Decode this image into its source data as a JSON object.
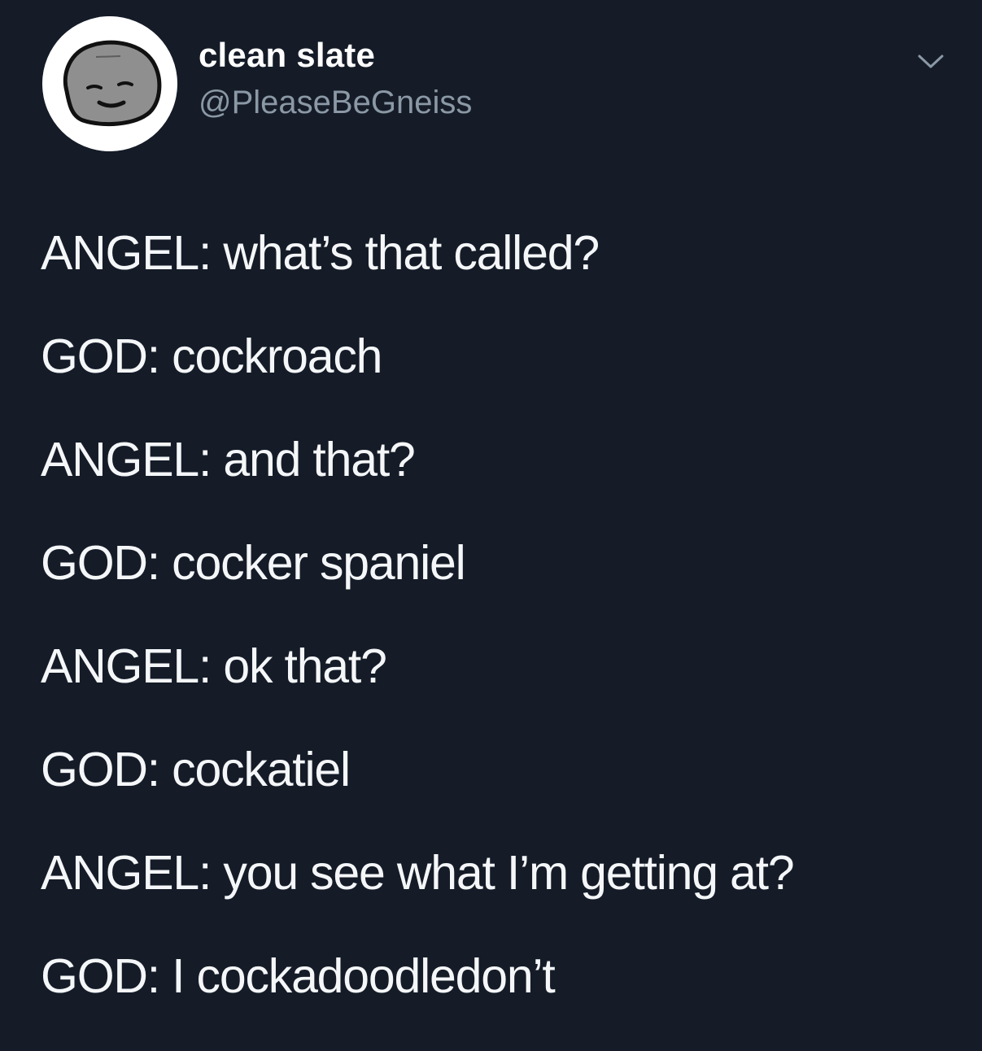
{
  "author": {
    "display_name": "clean slate",
    "handle": "@PleaseBeGneiss"
  },
  "icons": {
    "avatar": "rock-face-avatar",
    "menu": "chevron-down-icon"
  },
  "tweet": {
    "lines": [
      "ANGEL: what’s that called?",
      "GOD: cockroach",
      "ANGEL: and that?",
      "GOD: cocker spaniel",
      "ANGEL: ok that?",
      "GOD: cockatiel",
      "ANGEL: you see what I’m getting at?",
      "GOD: I cockadoodledon’t"
    ]
  },
  "colors": {
    "background": "#151c28",
    "text": "#f4f6f8",
    "handle": "#8b98a5"
  }
}
